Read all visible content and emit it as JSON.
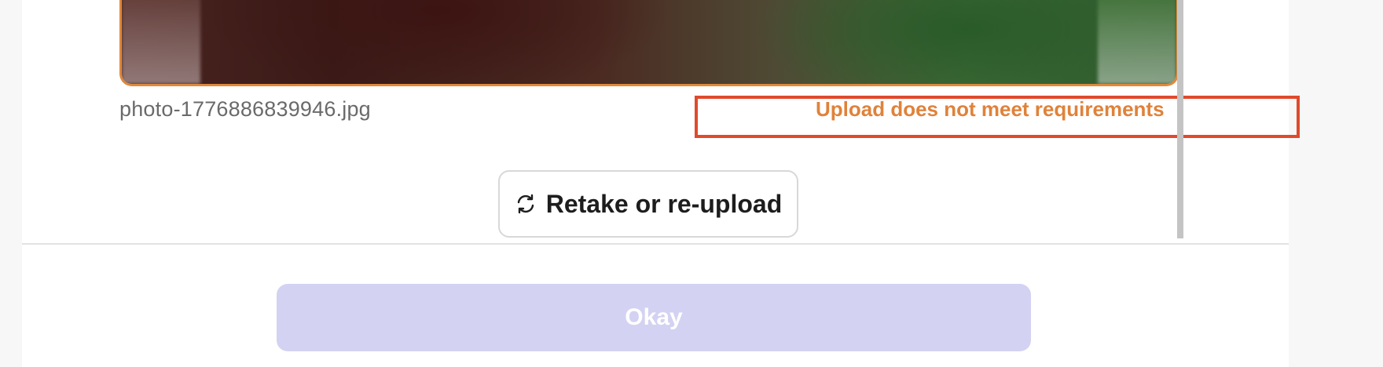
{
  "photo": {
    "filename": "photo-1776886839946.jpg",
    "status_message": "Upload does not meet requirements"
  },
  "actions": {
    "retake_label": "Retake or re-upload",
    "okay_label": "Okay"
  },
  "icons": {
    "retake": "refresh-icon"
  },
  "colors": {
    "warning_orange": "#e0823a",
    "highlight_red": "#e04a2c",
    "disabled_primary": "#d3d2f2"
  }
}
